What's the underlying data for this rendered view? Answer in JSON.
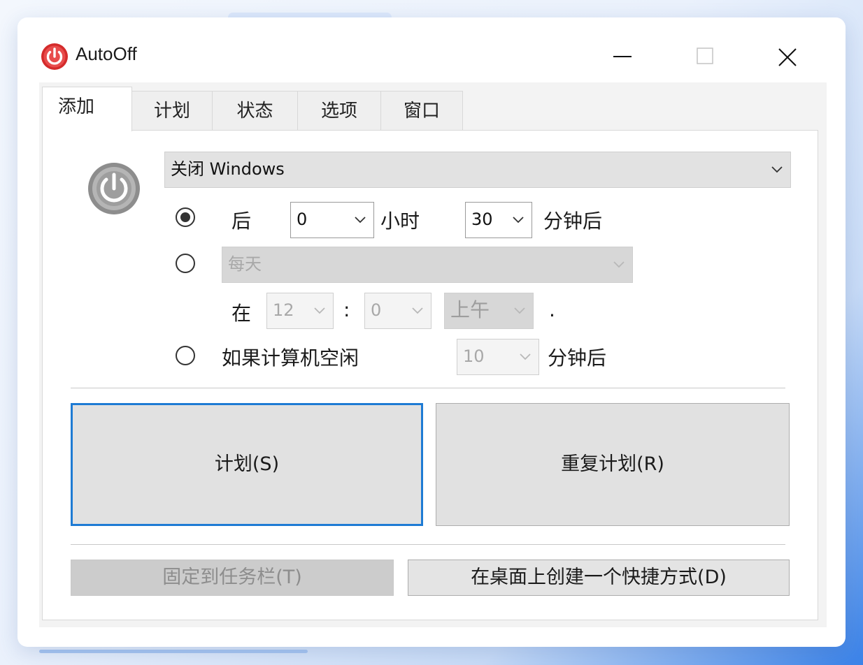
{
  "app": {
    "title": "AutoOff"
  },
  "colors": {
    "accent": "#1e7bd4",
    "app_icon": "#d42b2b"
  },
  "icons": {
    "app": "power-button-red",
    "action": "power-button-gray",
    "minimize": "minimize",
    "maximize": "maximize",
    "close": "close"
  },
  "tabs": [
    {
      "label": "添加",
      "active": true
    },
    {
      "label": "计划",
      "active": false
    },
    {
      "label": "状态",
      "active": false
    },
    {
      "label": "选项",
      "active": false
    },
    {
      "label": "窗口",
      "active": false
    }
  ],
  "action": {
    "selected": "关闭 Windows"
  },
  "after": {
    "label": "后",
    "hours_value": "0",
    "hours_unit": "小时",
    "minutes_value": "30",
    "minutes_unit": "分钟后",
    "selected": true
  },
  "daily": {
    "frequency": "每天",
    "at_label": "在",
    "hour": "12",
    "colon": ":",
    "minute": "0",
    "ampm": "上午",
    "trailing": ".",
    "selected": false
  },
  "idle": {
    "label": "如果计算机空闲",
    "minutes_value": "10",
    "minutes_unit": "分钟后",
    "selected": false
  },
  "buttons": {
    "schedule": "计划(S)",
    "repeat_schedule": "重复计划(R)",
    "pin_taskbar": "固定到任务栏(T)",
    "desktop_shortcut": "在桌面上创建一个快捷方式(D)"
  }
}
